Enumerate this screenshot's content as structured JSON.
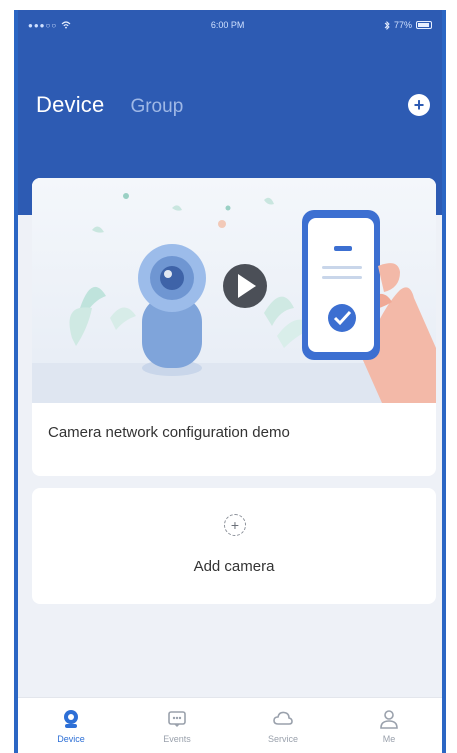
{
  "status_bar": {
    "signal": "●●●○○",
    "time": "6:00 PM",
    "battery": "77%"
  },
  "header": {
    "tab_active": "Device",
    "tab_inactive": "Group",
    "add_icon": "plus-circle-icon"
  },
  "banner": {
    "caption": "Camera network configuration demo",
    "play_icon": "play-icon"
  },
  "add_camera": {
    "label": "Add camera",
    "icon": "dashed-plus-icon"
  },
  "bottom_nav": [
    {
      "label": "Device",
      "icon": "camera-icon",
      "active": true
    },
    {
      "label": "Events",
      "icon": "events-icon",
      "active": false
    },
    {
      "label": "Service",
      "icon": "cloud-icon",
      "active": false
    },
    {
      "label": "Me",
      "icon": "user-icon",
      "active": false
    }
  ],
  "colors": {
    "brand": "#2d5bb3",
    "active_nav": "#2d6fd6",
    "background": "#eef1f7"
  }
}
